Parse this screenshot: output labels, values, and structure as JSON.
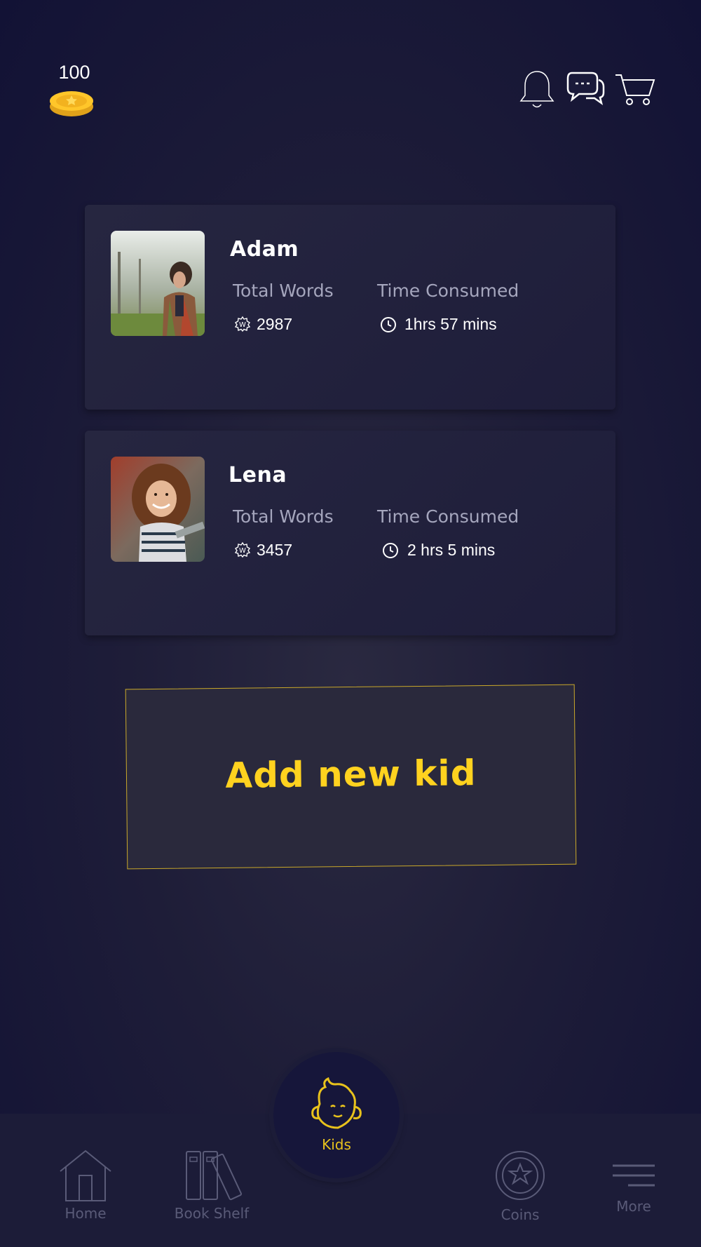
{
  "header": {
    "coins": "100",
    "icons": {
      "coin": "coin-icon",
      "bell": "bell-icon",
      "chat": "chat-icon",
      "cart": "cart-icon"
    }
  },
  "kids": [
    {
      "name": "Adam",
      "words_label": "Total Words",
      "words": "2987",
      "time_label": "Time Consumed",
      "time": "1hrs 57 mins"
    },
    {
      "name": "Lena",
      "words_label": "Total Words",
      "words": "3457",
      "time_label": "Time Consumed",
      "time": "2 hrs 5 mins"
    }
  ],
  "add_kid": {
    "label": "Add new kid"
  },
  "nav": {
    "home": "Home",
    "bookshelf": "Book Shelf",
    "kids": "Kids",
    "coins": "Coins",
    "more": "More"
  },
  "colors": {
    "accent": "#ffd21f",
    "background": "#1e1d38",
    "card": "#262640",
    "muted": "#5a5b78"
  }
}
